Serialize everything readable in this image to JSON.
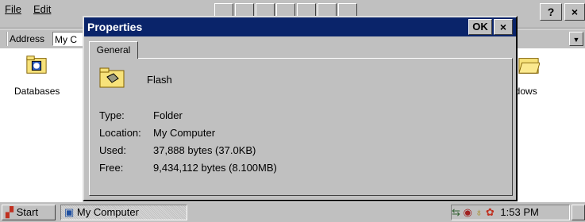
{
  "menubar": {
    "file": "File",
    "edit": "Edit"
  },
  "toolbar": {
    "help": "?",
    "close": "×"
  },
  "address": {
    "label": "Address",
    "value": "My C"
  },
  "files": [
    {
      "name": "Databases"
    },
    {
      "name": "ndows"
    }
  ],
  "dialog": {
    "title": "Properties",
    "ok": "OK",
    "close": "×",
    "tab": "General",
    "item_name": "Flash",
    "props": [
      {
        "label": "Type:",
        "value": "Folder"
      },
      {
        "label": "Location:",
        "value": "My Computer"
      },
      {
        "label": "Used:",
        "value": "37,888 bytes (37.0KB)"
      },
      {
        "label": "Free:",
        "value": "9,434,112 bytes (8.100MB)"
      }
    ]
  },
  "taskbar": {
    "start": "Start",
    "task": "My Computer",
    "time": "1:53 PM"
  },
  "colors": {
    "titlebar": "#0a246a",
    "chrome": "#c0c0c0",
    "folder": "#f7e27a"
  }
}
